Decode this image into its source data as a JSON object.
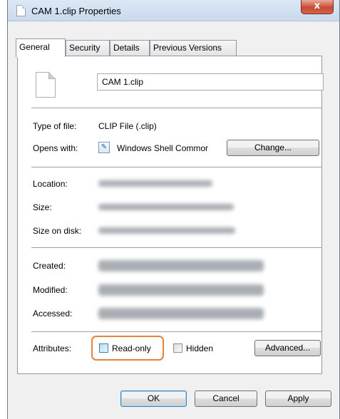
{
  "window": {
    "title": "CAM 1.clip Properties",
    "close_label": "x"
  },
  "tabs": [
    "General",
    "Security",
    "Details",
    "Previous Versions"
  ],
  "file": {
    "name": "CAM 1.clip"
  },
  "type_row": {
    "label": "Type of file:",
    "value": "CLIP File (.clip)"
  },
  "opens_row": {
    "label": "Opens with:",
    "value": "Windows Shell Commor",
    "change_label": "Change..."
  },
  "location_row": {
    "label": "Location:",
    "value": ""
  },
  "size_row": {
    "label": "Size:",
    "value": ""
  },
  "size_on_disk_row": {
    "label": "Size on disk:",
    "value": ""
  },
  "created_row": {
    "label": "Created:",
    "value": ""
  },
  "modified_row": {
    "label": "Modified:",
    "value": ""
  },
  "accessed_row": {
    "label": "Accessed:",
    "value": ""
  },
  "attributes": {
    "label": "Attributes:",
    "readonly_label": "Read-only",
    "readonly_checked": false,
    "hidden_label": "Hidden",
    "hidden_checked": false,
    "advanced_label": "Advanced..."
  },
  "footer": {
    "ok_label": "OK",
    "cancel_label": "Cancel",
    "apply_label": "Apply"
  },
  "colors": {
    "highlight": "#e8813a",
    "title_bar": "#c9daee",
    "close_button": "#c74a33"
  }
}
